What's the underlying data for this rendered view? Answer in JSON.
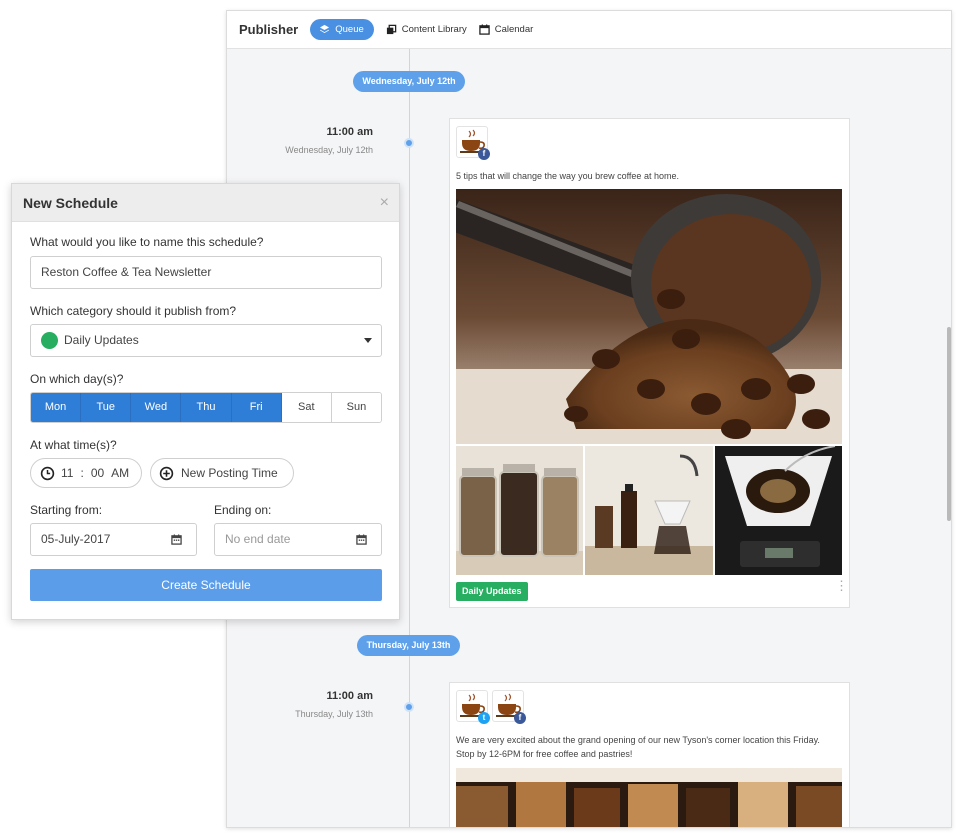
{
  "publisher": {
    "title": "Publisher",
    "nav": [
      {
        "label": "Queue",
        "icon": "layers-icon",
        "active": true
      },
      {
        "label": "Content Library",
        "icon": "library-icon",
        "active": false
      },
      {
        "label": "Calendar",
        "icon": "calendar-icon",
        "active": false
      }
    ]
  },
  "queue": [
    {
      "date_pill": "Wednesday, July 12th",
      "time": "11:00 am",
      "date": "Wednesday, July 12th",
      "networks": [
        "facebook"
      ],
      "text": "5 tips that will change the way you brew coffee at home.",
      "category": "Daily Updates"
    },
    {
      "date_pill": "Thursday, July 13th",
      "time": "11:00 am",
      "date": "Thursday, July 13th",
      "networks": [
        "twitter",
        "facebook"
      ],
      "text_line1": "We are very excited about the grand opening of our new Tyson's corner location this Friday.",
      "text_line2": "Stop by 12-6PM for free coffee and pastries!"
    }
  ],
  "colors": {
    "accent": "#4a90e2",
    "category_green": "#27ae60",
    "facebook": "#3b5998",
    "twitter": "#1da1f2",
    "button": "#5b9de8"
  },
  "modal": {
    "title": "New Schedule",
    "close": "×",
    "name_label": "What would you like to name this schedule?",
    "name_value": "Reston Coffee & Tea Newsletter",
    "category_label": "Which category should it publish from?",
    "category_value": "Daily Updates",
    "days_label": "On which day(s)?",
    "days": [
      {
        "label": "Mon",
        "selected": true
      },
      {
        "label": "Tue",
        "selected": true
      },
      {
        "label": "Wed",
        "selected": true
      },
      {
        "label": "Thu",
        "selected": true
      },
      {
        "label": "Fri",
        "selected": true
      },
      {
        "label": "Sat",
        "selected": false
      },
      {
        "label": "Sun",
        "selected": false
      }
    ],
    "time_label": "At what time(s)?",
    "time_hour": "11",
    "time_sep": ":",
    "time_min": "00",
    "time_ampm": "AM",
    "new_time_label": "New Posting Time",
    "start_label": "Starting from:",
    "start_value": "05-July-2017",
    "end_label": "Ending on:",
    "end_placeholder": "No end date",
    "create_label": "Create Schedule"
  }
}
